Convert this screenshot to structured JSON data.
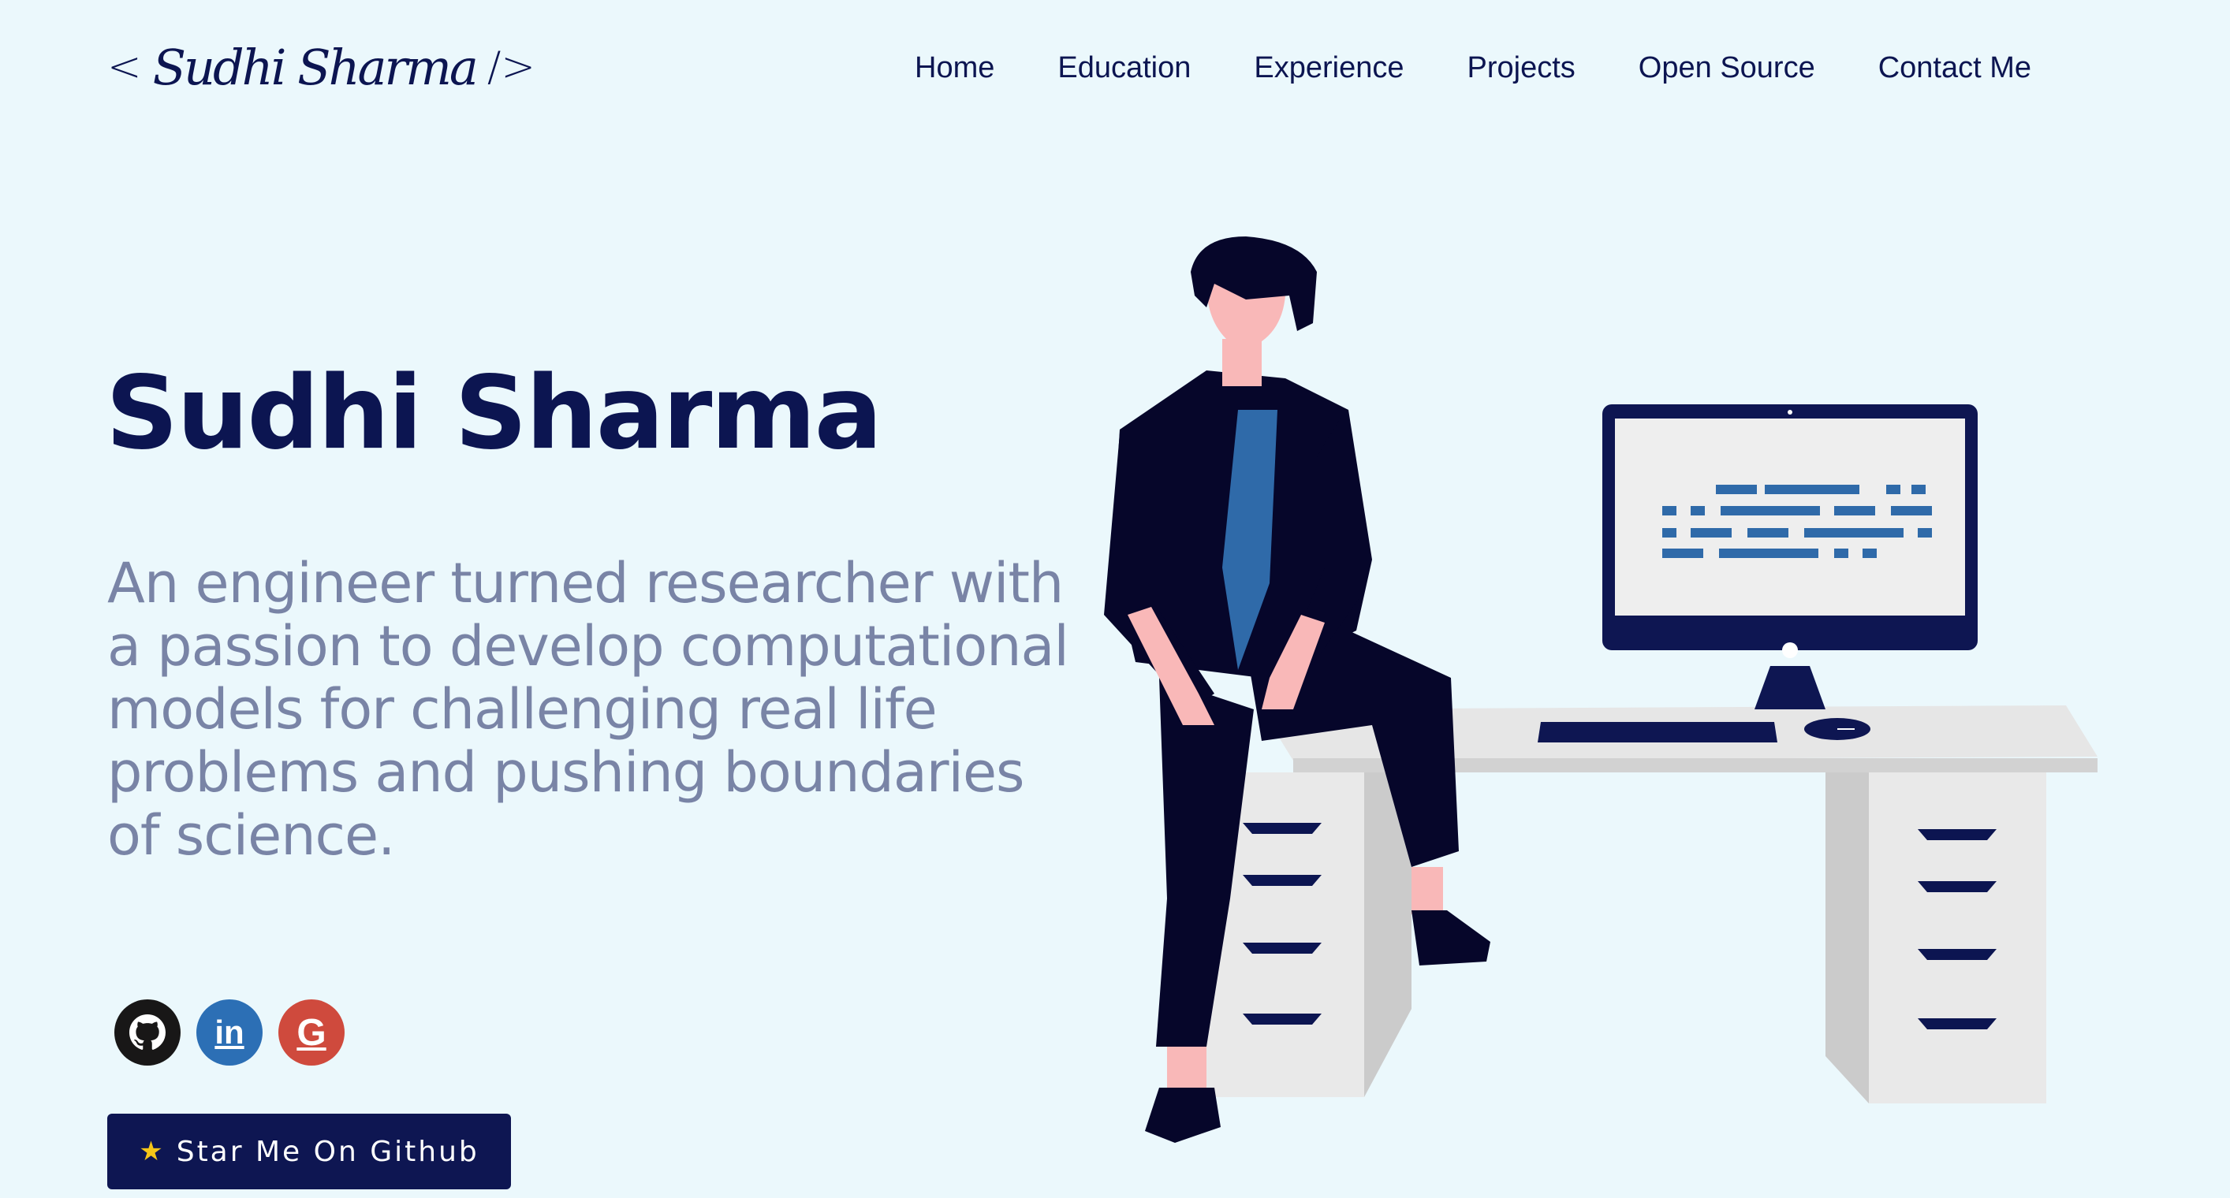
{
  "header": {
    "logo": {
      "open_bracket": "<",
      "signature": "Sudhi Sharma",
      "close_bracket": "/>"
    },
    "nav": [
      {
        "label": "Home"
      },
      {
        "label": "Education"
      },
      {
        "label": "Experience"
      },
      {
        "label": "Projects"
      },
      {
        "label": "Open Source"
      },
      {
        "label": "Contact Me"
      }
    ]
  },
  "hero": {
    "name": "Sudhi Sharma",
    "tagline": "An engineer turned researcher with a passion to develop computational models for challenging real life problems and pushing boundaries of science.",
    "social_links": [
      {
        "icon": "github-icon"
      },
      {
        "icon": "linkedin-icon",
        "glyph": "in"
      },
      {
        "icon": "google-icon",
        "glyph": "G"
      }
    ],
    "star_button": {
      "icon": "star-icon",
      "label": "Star Me On Github"
    }
  },
  "colors": {
    "background": "#ebf8fc",
    "primary": "#0c1551",
    "tagline": "#7984a6",
    "github": "#181717",
    "linkedin": "#2c6fb5",
    "google": "#cf4a3d",
    "accent_blue": "#2f6aa9"
  },
  "illustration": {
    "description_icon": "developer-at-desk-illustration"
  }
}
